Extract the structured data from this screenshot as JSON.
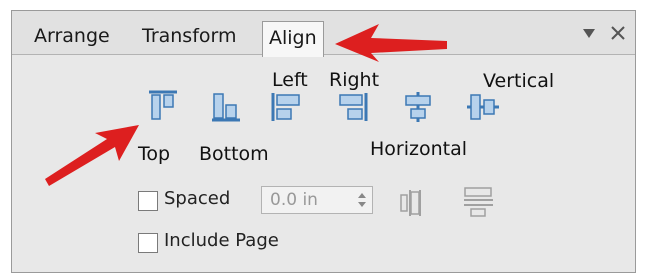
{
  "tabs": {
    "arrange": "Arrange",
    "transform": "Transform",
    "align": "Align"
  },
  "align_buttons": {
    "top": "Top",
    "bottom": "Bottom",
    "left": "Left",
    "right": "Right",
    "horizontal": "Horizontal",
    "vertical": "Vertical"
  },
  "spaced": {
    "label": "Spaced",
    "value": "0.0 in",
    "checked": false
  },
  "include_page": {
    "label": "Include Page",
    "checked": false
  },
  "colors": {
    "icon_blue": "#3c78b4",
    "icon_fill": "#b7d2ec",
    "annotation_red": "#dd1f1f",
    "disabled_gray": "#a0a0a0"
  }
}
